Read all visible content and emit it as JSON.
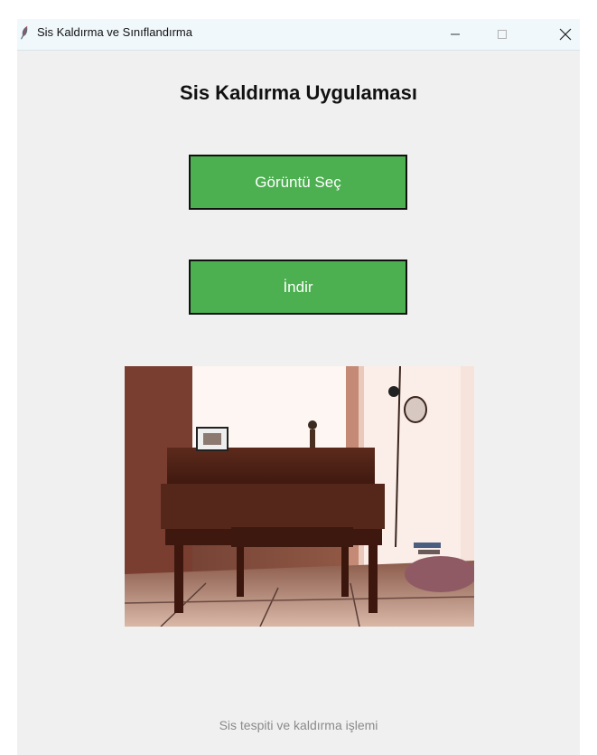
{
  "window": {
    "title": "Sis Kaldırma ve Sınıflandırma",
    "controls": {
      "minimize": "minimize-icon",
      "maximize": "maximize-icon",
      "close": "close-icon"
    }
  },
  "main": {
    "heading": "Sis Kaldırma Uygulaması",
    "select_button_label": "Görüntü Seç",
    "download_button_label": "İndir",
    "button_color": "#4caf50",
    "image_preview": "piano-in-room-photo",
    "status_text": "Sis tespiti ve kaldırma işlemi"
  }
}
